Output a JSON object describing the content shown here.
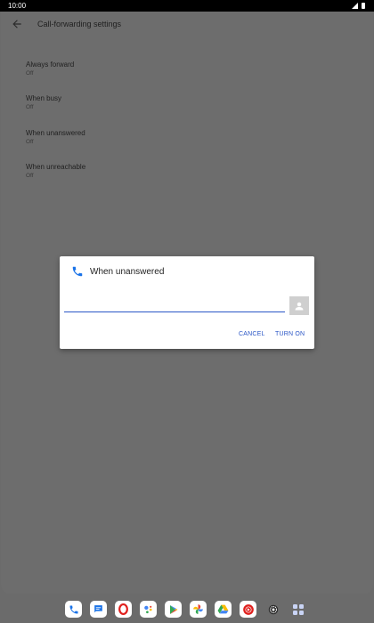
{
  "status_bar": {
    "time": "10:00"
  },
  "app_bar": {
    "title": "Call-forwarding settings"
  },
  "settings": [
    {
      "title": "Always forward",
      "value": "Off"
    },
    {
      "title": "When busy",
      "value": "Off"
    },
    {
      "title": "When unanswered",
      "value": "Off"
    },
    {
      "title": "When unreachable",
      "value": "Off"
    }
  ],
  "dialog": {
    "title": "When unanswered",
    "input_value": "",
    "cancel_label": "CANCEL",
    "confirm_label": "TURN ON"
  },
  "dock": {
    "apps": [
      "phone-icon",
      "messages-icon",
      "opera-icon",
      "assistant-icon",
      "play-store-icon",
      "photos-icon",
      "drive-icon",
      "youtube-music-icon",
      "settings-icon",
      "app-drawer-icon"
    ]
  },
  "colors": {
    "accent": "#2a56c6",
    "scrim": "#6d6d6d",
    "phone_blue": "#1a73e8"
  }
}
